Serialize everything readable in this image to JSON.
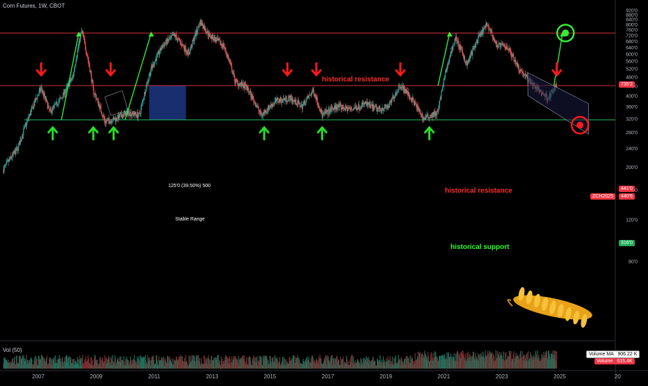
{
  "header": {
    "symbol_line": "Corn Futures, 1W, CBOT"
  },
  "volume_pane": {
    "label": "Vol (50)",
    "ma_label": "Volume MA",
    "ma_value": "906.22 K",
    "vol_label": "Volume",
    "vol_value": "615.4K"
  },
  "chart_data": {
    "type": "candlestick",
    "symbol": "Corn Futures",
    "interval": "1W",
    "exchange": "CBOT",
    "y_ticks": [
      "920'0",
      "880'0",
      "840'0",
      "800'0",
      "760'0",
      "720'0",
      "680'0",
      "640'0",
      "600'0",
      "560'0",
      "520'0",
      "480'0",
      "440'0",
      "400'0",
      "360'0",
      "320'0",
      "280'0",
      "240'0",
      "200'0",
      "160'0",
      "120'0",
      "80'0"
    ],
    "x_ticks": [
      "2007",
      "2009",
      "2011",
      "2013",
      "2015",
      "2017",
      "2019",
      "2021",
      "2023",
      "2025",
      "20"
    ],
    "ylim": [
      40,
      960
    ],
    "scale": "log",
    "xlim": [
      2005.8,
      2027.2
    ],
    "price_path": [
      [
        2005.8,
        195
      ],
      [
        2006.3,
        240
      ],
      [
        2006.7,
        330
      ],
      [
        2007.1,
        430
      ],
      [
        2007.4,
        340
      ],
      [
        2007.8,
        390
      ],
      [
        2008.2,
        480
      ],
      [
        2008.5,
        750
      ],
      [
        2008.9,
        420
      ],
      [
        2009.3,
        310
      ],
      [
        2009.7,
        320
      ],
      [
        2010.1,
        340
      ],
      [
        2010.5,
        330
      ],
      [
        2010.9,
        520
      ],
      [
        2011.3,
        650
      ],
      [
        2011.7,
        720
      ],
      [
        2012.2,
        600
      ],
      [
        2012.6,
        820
      ],
      [
        2012.9,
        720
      ],
      [
        2013.4,
        650
      ],
      [
        2013.8,
        460
      ],
      [
        2014.2,
        430
      ],
      [
        2014.7,
        330
      ],
      [
        2015.2,
        380
      ],
      [
        2015.7,
        390
      ],
      [
        2016.1,
        360
      ],
      [
        2016.5,
        420
      ],
      [
        2016.8,
        330
      ],
      [
        2017.3,
        360
      ],
      [
        2017.8,
        350
      ],
      [
        2018.3,
        370
      ],
      [
        2018.7,
        350
      ],
      [
        2019.1,
        360
      ],
      [
        2019.5,
        445
      ],
      [
        2019.9,
        385
      ],
      [
        2020.3,
        320
      ],
      [
        2020.8,
        340
      ],
      [
        2021.1,
        520
      ],
      [
        2021.4,
        700
      ],
      [
        2021.8,
        540
      ],
      [
        2022.2,
        700
      ],
      [
        2022.5,
        800
      ],
      [
        2022.8,
        660
      ],
      [
        2023.2,
        640
      ],
      [
        2023.6,
        520
      ],
      [
        2023.9,
        470
      ],
      [
        2024.2,
        430
      ],
      [
        2024.6,
        390
      ],
      [
        2024.9,
        440
      ]
    ],
    "levels": [
      {
        "name": "historical resistance",
        "value": 735.2,
        "price_label": "735'2"
      },
      {
        "name": "historical resistance",
        "value": 441.0,
        "price_label": "441'0"
      },
      {
        "name": "historical support",
        "value": 316.0,
        "price_label": "316'0"
      }
    ],
    "current_price": {
      "symbol": "ZCH2025",
      "price_label": "440'6"
    },
    "stable_range": {
      "label": "Stable Range",
      "measure": "125'0 (39.50%) 500",
      "from": 2010.9,
      "to": 2012.1,
      "low": 316,
      "high": 441
    },
    "annotations": {
      "resistance_top_text": "historical resistance",
      "resistance_mid_text": "historical resistance",
      "support_text": "historical support"
    },
    "down_arrows_x": [
      2007.1,
      2009.5,
      2015.6,
      2016.6,
      2019.5,
      2024.9
    ],
    "up_arrows_x": [
      2007.5,
      2008.9,
      2009.6,
      2014.8,
      2016.8,
      2020.5
    ],
    "projections": [
      {
        "from": [
          2007.8,
          316
        ],
        "to": [
          2008.4,
          735.2
        ]
      },
      {
        "from": [
          2010.0,
          316
        ],
        "to": [
          2010.9,
          735.2
        ]
      },
      {
        "from": [
          2020.8,
          441
        ],
        "to": [
          2021.2,
          735.2
        ]
      },
      {
        "from": [
          2024.8,
          441
        ],
        "to": [
          2025.1,
          735.2
        ]
      }
    ],
    "colors": {
      "up": "#26a69a",
      "down": "#ef5350",
      "resistance": "#f23645",
      "support": "#22ab5a",
      "arrow_green": "#26e026",
      "arrow_red": "#ff1a1a",
      "range_fill": "#1e3a8a"
    }
  }
}
